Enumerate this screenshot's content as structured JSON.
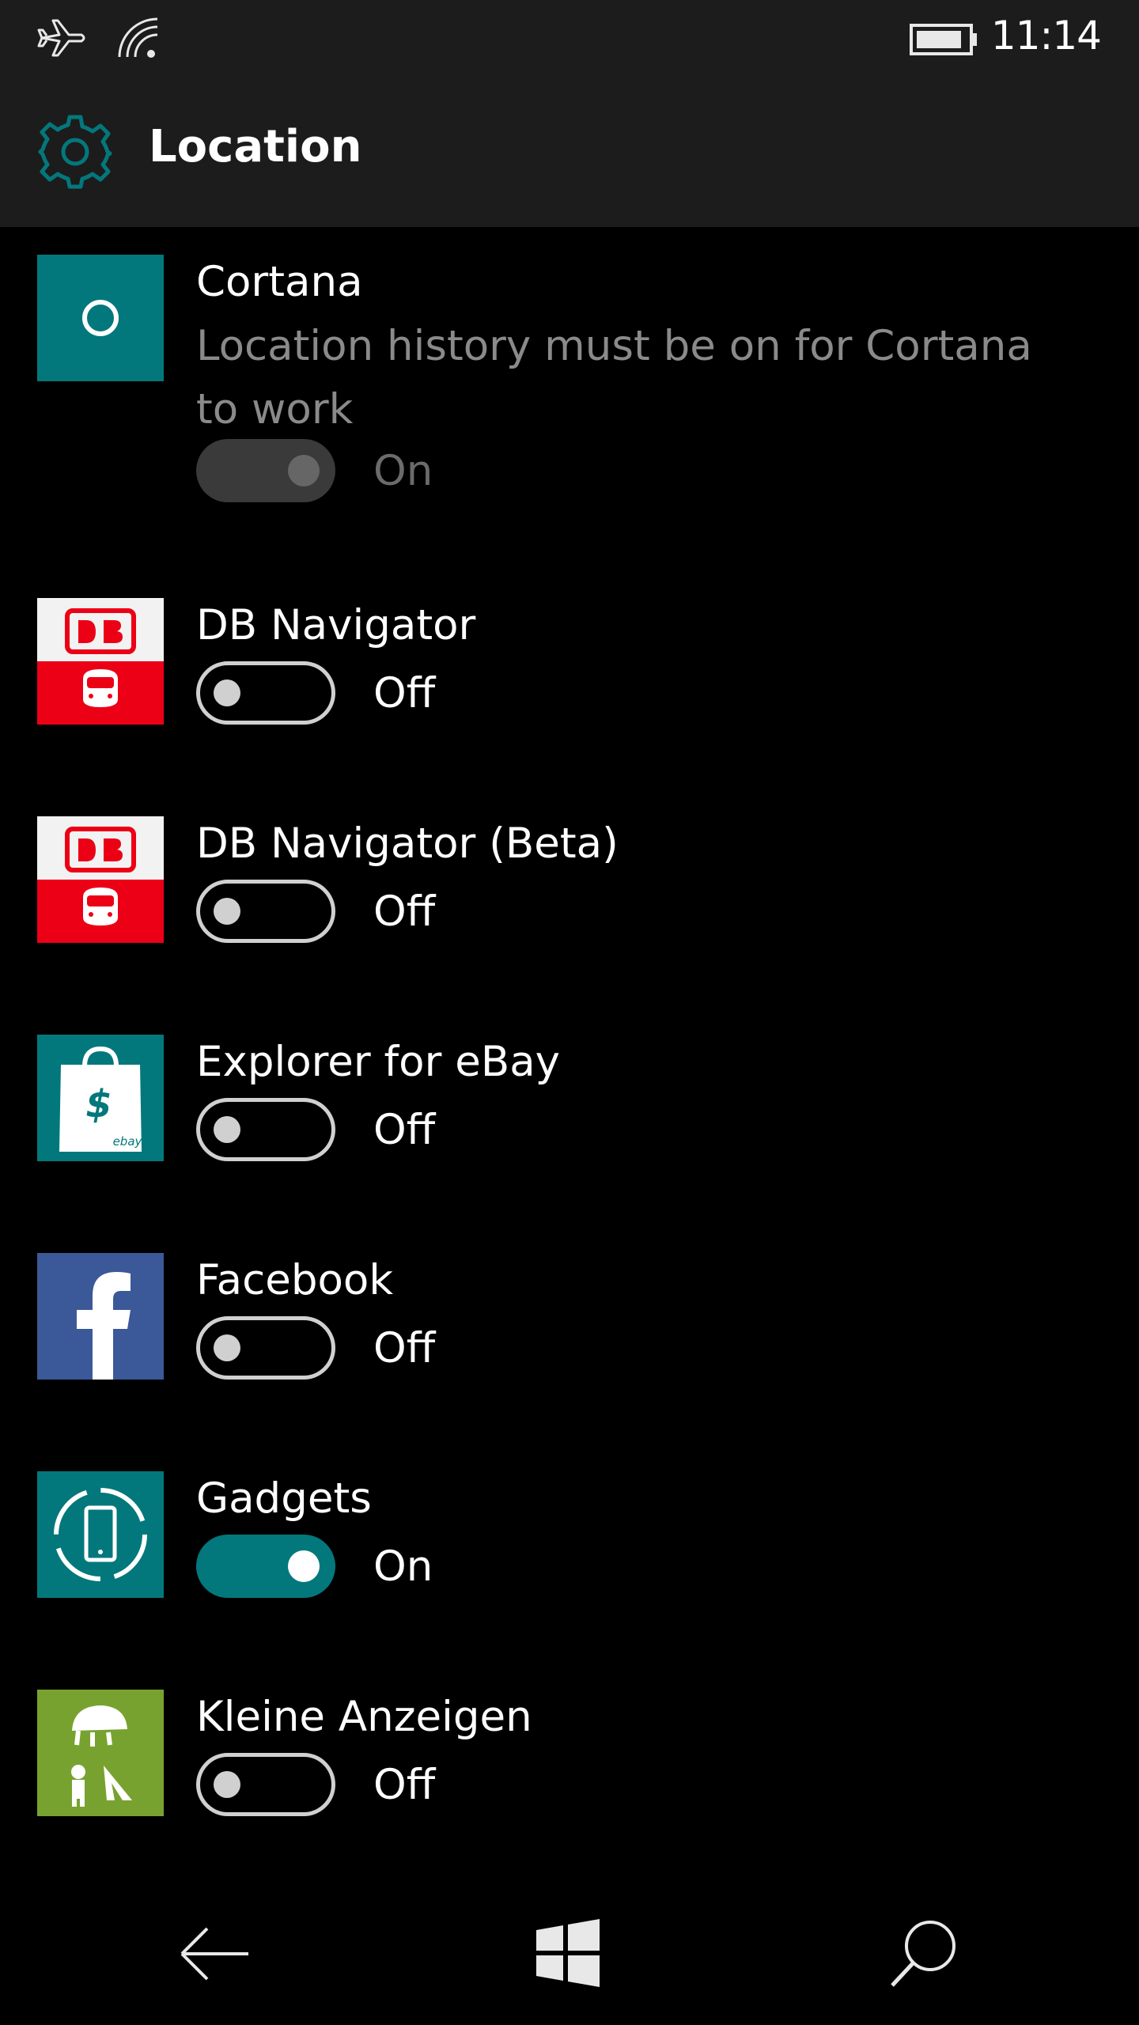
{
  "status_bar": {
    "time": "11:14",
    "icons": [
      "airplane-icon",
      "wifi-icon",
      "battery-icon"
    ]
  },
  "header": {
    "icon": "gear-icon",
    "title": "Location"
  },
  "colors": {
    "accent": "#03787c",
    "header_bg": "#1c1c1c",
    "background": "#000000",
    "db_red": "#ec0016",
    "facebook_blue": "#3b5998",
    "kleine_green": "#78a22f"
  },
  "apps": [
    {
      "name": "Cortana",
      "description": "Location history must be on for Cortana to work",
      "state": "On",
      "enabled": false,
      "icon": "cortana-icon"
    },
    {
      "name": "DB Navigator",
      "state": "Off",
      "icon": "db-navigator-icon"
    },
    {
      "name": "DB Navigator (Beta)",
      "state": "Off",
      "icon": "db-navigator-beta-icon"
    },
    {
      "name": "Explorer for eBay",
      "state": "Off",
      "icon": "ebay-bag-icon",
      "icon_text": "ebay"
    },
    {
      "name": "Facebook",
      "state": "Off",
      "icon": "facebook-icon"
    },
    {
      "name": "Gadgets",
      "state": "On",
      "icon": "gadgets-icon"
    },
    {
      "name": "Kleine Anzeigen",
      "state": "Off",
      "icon": "kleine-anzeigen-icon"
    }
  ],
  "nav_bar": {
    "buttons": [
      "back-arrow-icon",
      "windows-start-icon",
      "search-icon"
    ]
  }
}
